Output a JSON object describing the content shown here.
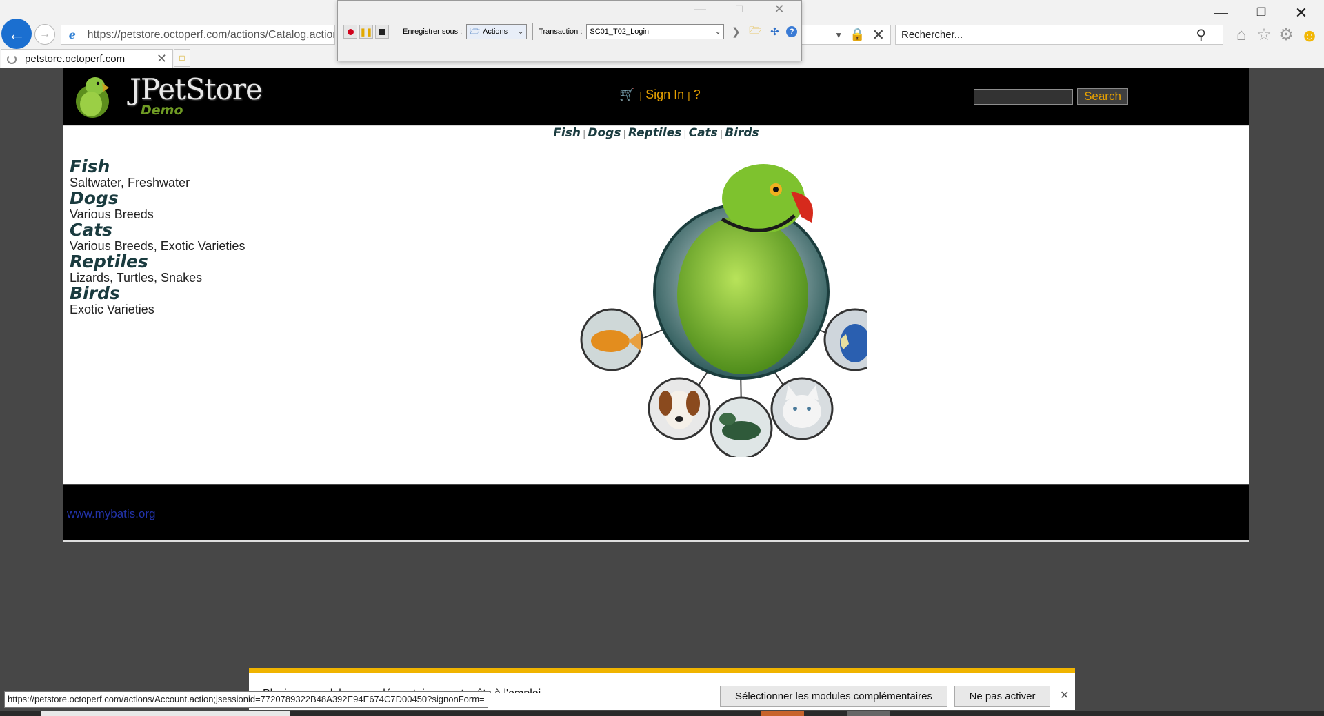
{
  "browser": {
    "address_url": "https://petstore.octoperf.com/actions/Catalog.action",
    "search_placeholder": "Rechercher...",
    "tab_title": "petstore.octoperf.com",
    "icons": [
      "back-arrow-icon",
      "forward-arrow-icon",
      "ie-page-icon",
      "dropdown-icon",
      "lock-icon",
      "stop-icon",
      "search-icon",
      "home-icon",
      "favorites-star-icon",
      "gear-icon",
      "smiley-icon"
    ]
  },
  "recorder": {
    "save_label": "Enregistrer sous :",
    "save_value": "Actions",
    "transaction_label": "Transaction :",
    "transaction_value": "SC01_T02_Login"
  },
  "header": {
    "logo_title": "JPetStore",
    "logo_subtitle": "Demo",
    "sign_in": "Sign In",
    "help": "?",
    "separator": "|",
    "search_button": "Search"
  },
  "quicklinks": [
    "Fish",
    "Dogs",
    "Reptiles",
    "Cats",
    "Birds"
  ],
  "sidebar": [
    {
      "name": "Fish",
      "desc": "Saltwater, Freshwater"
    },
    {
      "name": "Dogs",
      "desc": "Various Breeds"
    },
    {
      "name": "Cats",
      "desc": "Various Breeds, Exotic Varieties"
    },
    {
      "name": "Reptiles",
      "desc": "Lizards, Turtles, Snakes"
    },
    {
      "name": "Birds",
      "desc": "Exotic Varieties"
    }
  ],
  "footer": {
    "link": "www.mybatis.org"
  },
  "notification": {
    "message": "Plusieurs modules complémentaires sont prêts à l'emploi.",
    "select_button": "Sélectionner les modules complémentaires",
    "deny_button": "Ne pas activer"
  },
  "status_url": "https://petstore.octoperf.com/actions/Account.action;jsessionid=7720789322B48A392E94E674C7D00450?signonForm=",
  "colors": {
    "accent": "#e8a200",
    "category": "#1a3b3f",
    "notification": "#f0b400",
    "link": "#2233aa"
  }
}
